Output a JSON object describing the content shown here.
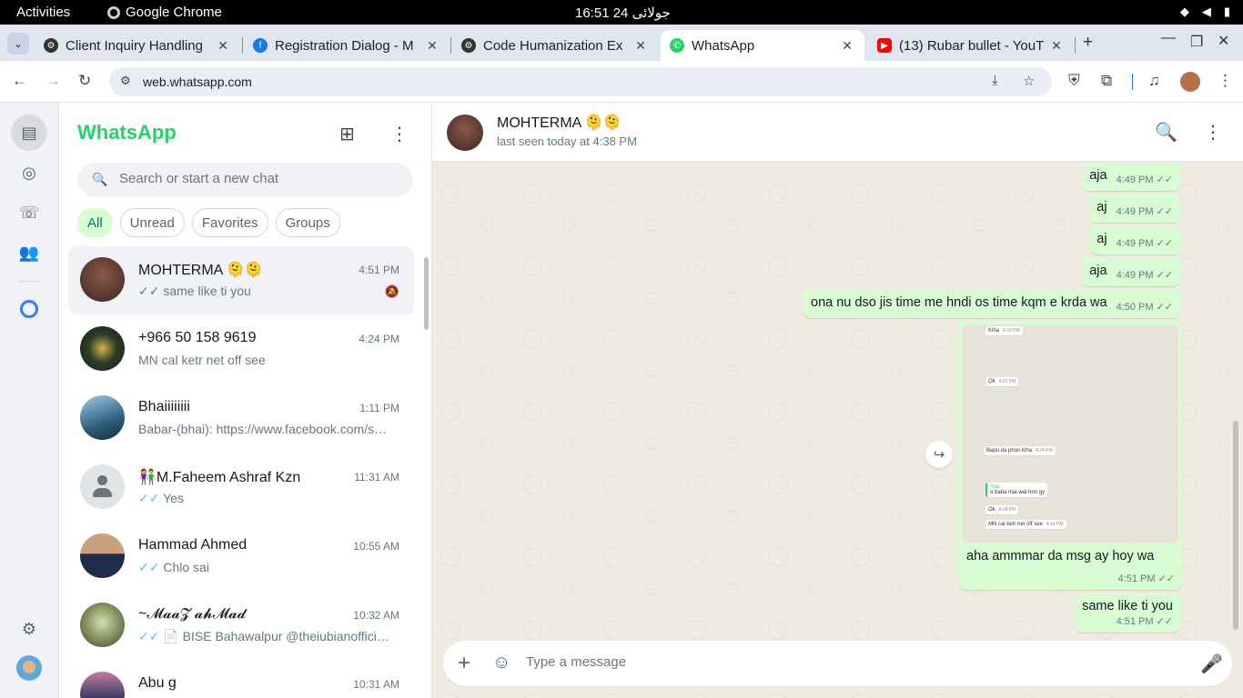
{
  "system_bar": {
    "activities": "Activities",
    "app_name": "Google Chrome",
    "clock": "16:51  24 جولائی"
  },
  "browser": {
    "tabs": [
      {
        "title": "Client Inquiry Handling",
        "icon": "chatgpt-icon"
      },
      {
        "title": "Registration Dialog - M",
        "icon": "facebook-icon"
      },
      {
        "title": "Code Humanization Ex",
        "icon": "chatgpt-icon"
      },
      {
        "title": "WhatsApp",
        "icon": "whatsapp-icon",
        "active": true
      },
      {
        "title": "(13) Rubar bullet - YouT",
        "icon": "youtube-icon"
      }
    ],
    "url": "web.whatsapp.com",
    "accent": "#dfe6ef"
  },
  "whatsapp": {
    "title": "WhatsApp",
    "brand_color": "#25d366",
    "search_placeholder": "Search or start a new chat",
    "filters": [
      "All",
      "Unread",
      "Favorites",
      "Groups"
    ],
    "chats": [
      {
        "name": "MOHTERMA 🫠🫠",
        "time": "4:51 PM",
        "tick": "✓✓",
        "preview": "same like ti you",
        "muted": true,
        "avatar_color": "#5a3a32",
        "tick_read": false
      },
      {
        "name": "+966 50 158 9619",
        "time": "4:24 PM",
        "tick": "",
        "preview": "MN cal ketr net off see",
        "avatar_color": "#2c3e28"
      },
      {
        "name": "Bhaiiiiiiii",
        "time": "1:11 PM",
        "tick": "",
        "preview": "Babar-(bhai): https://www.facebook.com/s…",
        "avatar_color": "#2f5f7a"
      },
      {
        "name": "👫M.Faheem Ashraf Kzn",
        "time": "11:31 AM",
        "tick": "✓✓",
        "preview": "Yes",
        "avatar_color": "#dfe5e7",
        "default_avatar": true,
        "tick_read": true
      },
      {
        "name": "Hammad Ahmed",
        "time": "10:55 AM",
        "tick": "✓✓",
        "preview": "Chlo sai",
        "avatar_color": "#2a3b55",
        "tick_read": true
      },
      {
        "name": "~𝓜𝓪𝓪𝓩 𝓪𝓱𝓜𝓪𝓭",
        "time": "10:32 AM",
        "tick": "✓✓",
        "preview": "📄 BISE Bahawalpur @theiubianofficial …",
        "avatar_color": "#7d8a5a",
        "tick_read": true
      },
      {
        "name": "Abu g",
        "time": "10:31 AM",
        "tick": "",
        "preview": "",
        "avatar_color": "#3b3a6a"
      }
    ],
    "conversation": {
      "name": "MOHTERMA 🫠🫠",
      "status": "last seen today at 4:38 PM",
      "messages": [
        {
          "text": "aja",
          "time": "4:49 PM"
        },
        {
          "text": "aj",
          "time": "4:49 PM"
        },
        {
          "text": "aj",
          "time": "4:49 PM"
        },
        {
          "text": "aja",
          "time": "4:49 PM"
        },
        {
          "text": "ona nu dso jis time me hndi os time kqm e krda wa",
          "time": "4:50 PM"
        }
      ],
      "image_message": {
        "caption": "aha ammmar da msg ay hoy wa",
        "time": "4:51 PM",
        "screenshot_lines": [
          {
            "text": "Kiha",
            "time": "4:23 PM"
          },
          {
            "text": "Ok",
            "time": "4:23 PM"
          },
          {
            "text": "Bapu da phon kiha",
            "time": "4:24 PM"
          },
          {
            "text": "You",
            "time": ""
          },
          {
            "text": "o baba mai wal hon gy",
            "time": ""
          },
          {
            "text": "Ok",
            "time": "4:24 PM"
          },
          {
            "text": "MN cal ketr net off see",
            "time": "4:24 PM"
          }
        ]
      },
      "last_message": {
        "text": "same like ti you",
        "time": "4:51 PM"
      },
      "composer_placeholder": "Type a message"
    }
  }
}
